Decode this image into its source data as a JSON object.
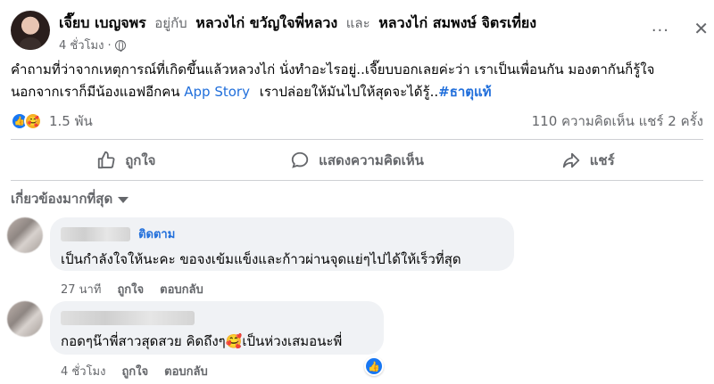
{
  "post": {
    "author": "เจี๊ยบ เบญจพร",
    "with_label": "อยู่กับ",
    "tag1": "หลวงไก่ ขวัญใจพี่หลวง",
    "and_label": "และ",
    "tag2": "หลวงไก่ สมพงษ์ จิตรเที่ยง",
    "time": "4 ชั่วโมง ·",
    "privacy_icon": "globe-icon",
    "text_part1": "คำถามที่ว่าจากเหตุการณ์ที่เกิดขึ้นแล้วหลวงไก่ นั่งทำอะไรอยู่..เจี๊ยบบอกเลยค่ะว่า เราเป็นเพื่อนกัน มองตากันก็รู้ใจ นอกจากเราก็มีน้องแอฟอีกคน",
    "link_text": "App Story",
    "text_part2": "เราปล่อยให้มันไปให้สุดจะได้รู้..",
    "hashtag": "#ธาตุแท้"
  },
  "stats": {
    "reaction_count": "1.5 พัน",
    "comments_shares": "110 ความคิดเห็น  แชร์ 2 ครั้ง"
  },
  "actions": {
    "like": "ถูกใจ",
    "comment": "แสดงความคิดเห็น",
    "share": "แชร์"
  },
  "sort_label": "เกี่ยวข้องมากที่สุด",
  "comments": [
    {
      "follow_label": "ติดตาม",
      "text": "เป็นกำลังใจให้นะคะ ขอจงเข้มแข็งและก้าวผ่านจุดแย่ๆไปได้ให้เร็วที่สุด",
      "time": "27 นาที",
      "like": "ถูกใจ",
      "reply": "ตอบกลับ"
    },
    {
      "text": "กอดๆน๊าพี่สาวสุดสวย คิดถึงๆ🥰เป็นห่วงเสมอนะพี่",
      "time": "4 ชั่วโมง",
      "like": "ถูกใจ",
      "reply": "ตอบกลับ"
    }
  ],
  "colors": {
    "accent": "#216fdb",
    "like_blue": "#1877f2",
    "muted": "#65676b",
    "bubble": "#f0f2f5"
  }
}
